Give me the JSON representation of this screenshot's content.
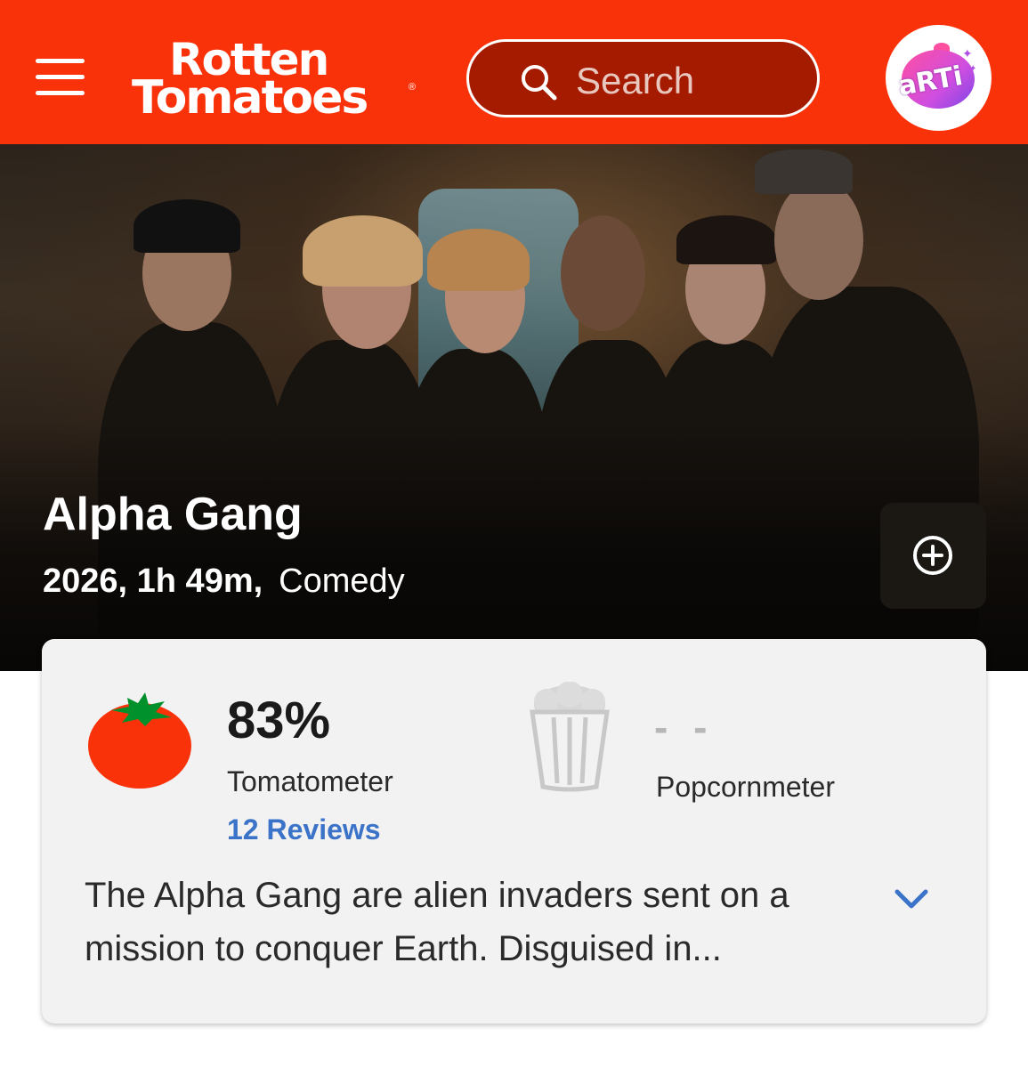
{
  "header": {
    "logo_line1": "Rotten",
    "logo_line2": "Tomatoes",
    "logo_reg": "®",
    "search_placeholder": "Search",
    "avatar_text": "aRTi",
    "brand_color": "#fa320a"
  },
  "movie": {
    "title": "Alpha Gang",
    "meta_year_runtime": "2026, 1h 49m,",
    "genre": "Comedy"
  },
  "scores": {
    "tomatometer_value": "83%",
    "tomatometer_label": "Tomatometer",
    "reviews_link": "12 Reviews",
    "popcornmeter_value": "- -",
    "popcornmeter_label": "Popcornmeter"
  },
  "synopsis": {
    "text": "The Alpha Gang are alien invaders sent on a mission to conquer Earth. Disguised in..."
  },
  "icons": {
    "menu": "hamburger-menu-icon",
    "search": "search-icon",
    "add": "plus-circle-icon",
    "expand": "chevron-down-icon",
    "tomato": "fresh-tomato-icon",
    "popcorn": "popcorn-bucket-icon"
  }
}
